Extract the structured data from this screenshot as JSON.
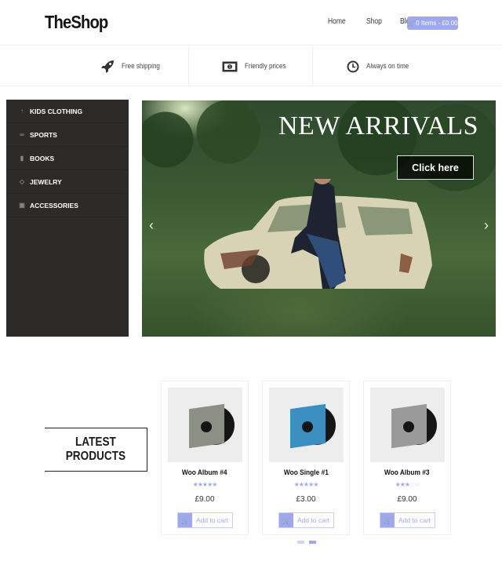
{
  "header": {
    "logo": "TheShop",
    "nav": [
      {
        "label": "Home"
      },
      {
        "label": "Shop"
      },
      {
        "label": "Blog"
      }
    ],
    "cart": {
      "label": "0 Items - £0.00",
      "icon": "shopping-cart-icon"
    }
  },
  "features": [
    {
      "label": "Free shipping",
      "icon": "rocket-icon"
    },
    {
      "label": "Friendly prices",
      "icon": "money-bill-icon"
    },
    {
      "label": "Always on time",
      "icon": "clock-icon"
    }
  ],
  "sidebar": {
    "items": [
      {
        "label": "KIDS CLOTHING",
        "icon": "child-icon"
      },
      {
        "label": "SPORTS",
        "icon": "bicycle-icon"
      },
      {
        "label": "BOOKS",
        "icon": "book-icon"
      },
      {
        "label": "JEWELRY",
        "icon": "diamond-icon"
      },
      {
        "label": "ACCESSORIES",
        "icon": "briefcase-icon"
      }
    ]
  },
  "hero": {
    "title": "NEW ARRIVALS",
    "button": "Click here",
    "prev": "‹",
    "next": "›"
  },
  "latest": {
    "line1": "LATEST",
    "line2": "PRODUCTS"
  },
  "products": [
    {
      "name": "Woo Album #4",
      "rating": 5,
      "price": "£9.00",
      "button": "Add to cart",
      "cover": "#8c8f84"
    },
    {
      "name": "Woo Single #1",
      "rating": 5,
      "price": "£3.00",
      "button": "Add to cart",
      "cover": "#3a8fc0"
    },
    {
      "name": "Woo Album #3",
      "rating": 3,
      "price": "£9.00",
      "button": "Add to cart",
      "cover": "#9a9a9a"
    }
  ],
  "carousel": {
    "pages": 2,
    "active": 2
  },
  "colors": {
    "accent": "#9fa8ec",
    "sidebar_bg": "#2d2a2a",
    "text_dark": "#141414"
  }
}
